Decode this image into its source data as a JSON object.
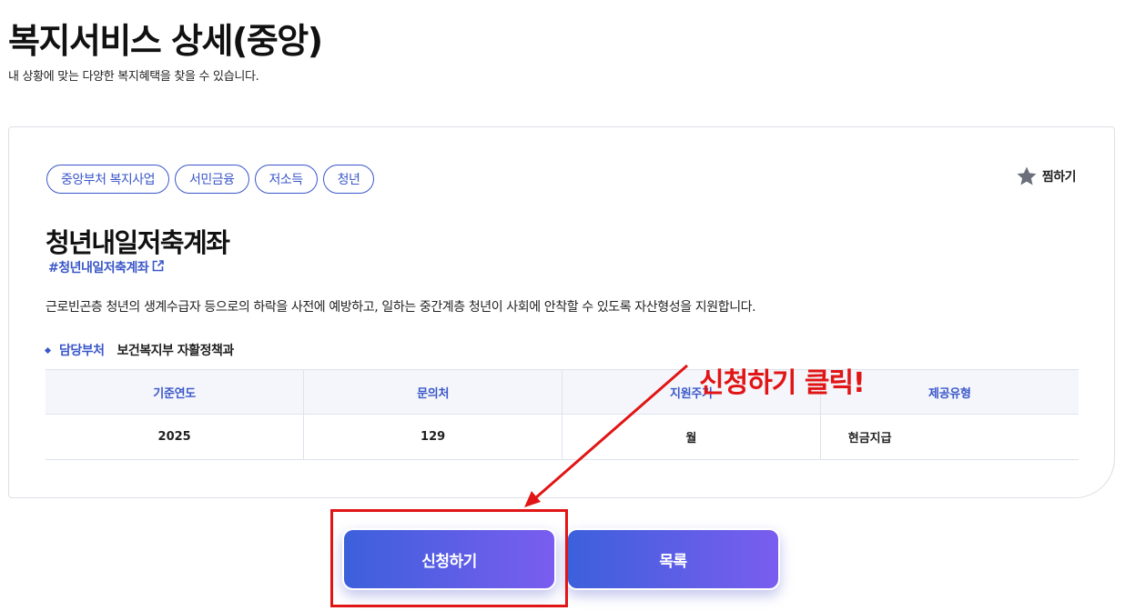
{
  "page": {
    "title": "복지서비스 상세(중앙)",
    "subtitle": "내 상황에 맞는 다양한 복지혜택을 찾을 수 있습니다."
  },
  "tags": [
    "중앙부처 복지사업",
    "서민금융",
    "저소득",
    "청년"
  ],
  "favorite": {
    "label": "찜하기",
    "icon": "star-icon"
  },
  "service": {
    "title": "청년내일저축계좌",
    "hashtag": "#청년내일저축계좌",
    "description": "근로빈곤층 청년의 생계수급자 등으로의 하락을 사전에 예방하고, 일하는 중간계층 청년이 사회에 안착할 수 있도록 자산형성을 지원합니다.",
    "department_label": "담당부처",
    "department_value": "보건복지부 자활정책과"
  },
  "info_table": {
    "headers": [
      "기준연도",
      "문의처",
      "지원주기",
      "제공유형"
    ],
    "values": [
      "2025",
      "129",
      "월",
      "현금지급"
    ]
  },
  "buttons": {
    "apply": "신청하기",
    "list": "목록"
  },
  "annotation": {
    "text": "신청하기 클릭!",
    "color": "#e11515"
  },
  "colors": {
    "accent": "#3a57c9",
    "button_gradient_start": "#3c60db",
    "button_gradient_end": "#7a5df0"
  }
}
